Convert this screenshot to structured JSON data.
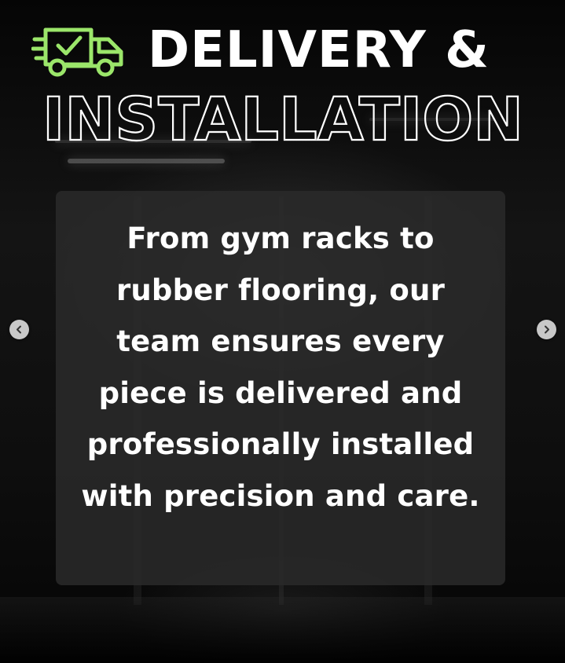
{
  "slide": {
    "title_line1": "DELIVERY &",
    "title_line2": "INSTALLATION",
    "body_text": "From gym racks to rubber flooring, our team ensures every piece is delivered and professionally installed with precision and care.",
    "icon": "delivery-truck-check-icon"
  },
  "carousel": {
    "prev_icon": "chevron-left-icon",
    "next_icon": "chevron-right-icon"
  },
  "colors": {
    "accent": "#9be66a",
    "title_text": "#ffffff",
    "card_bg": "#2a2a2a",
    "background": "#0a0a0a"
  }
}
